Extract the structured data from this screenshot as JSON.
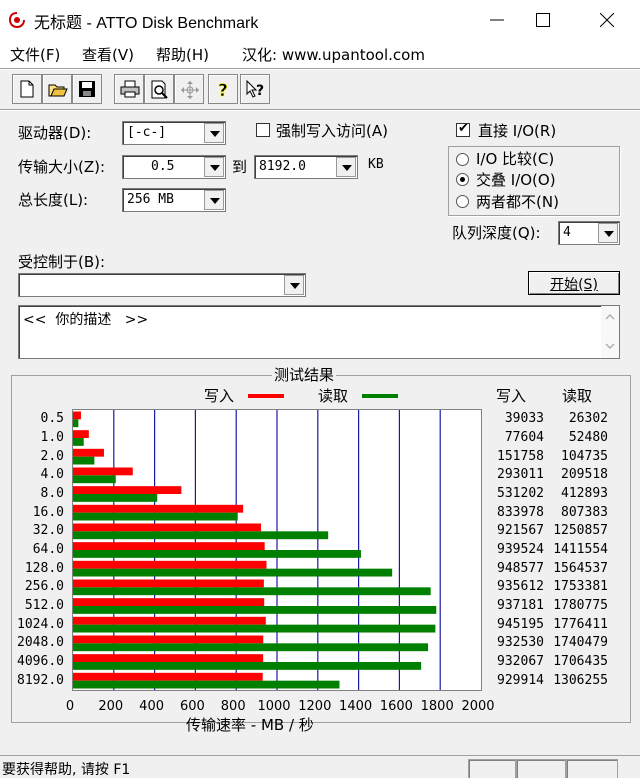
{
  "window": {
    "title": "无标题 - ATTO Disk Benchmark"
  },
  "menu": {
    "file": "文件(F)",
    "view": "查看(V)",
    "help": "帮助(H)",
    "localized": "汉化: www.upantool.com"
  },
  "toolbar": {
    "icons": [
      "new-file-icon",
      "open-folder-icon",
      "save-icon",
      "print-icon",
      "print-preview-icon",
      "move-icon",
      "help-icon",
      "context-help-icon"
    ]
  },
  "settings": {
    "drive_label": "驱动器(D):",
    "drive_value": "[-c-]",
    "transfer_label": "传输大小(Z):",
    "transfer_from": "0.5",
    "to_label": "到",
    "transfer_to": "8192.0",
    "kb_label": "KB",
    "length_label": "总长度(L):",
    "length_value": "256 MB",
    "force_write_label": "强制写入访问(A)",
    "force_write_checked": false,
    "direct_io_label": "直接 I/O(R)",
    "direct_io_checked": true,
    "io_compare_label": "I/O 比较(C)",
    "overlapped_io_label": "交叠 I/O(O)",
    "neither_label": "两者都不(N)",
    "io_mode_selected": "overlapped",
    "queue_depth_label": "队列深度(Q):",
    "queue_depth_value": "4",
    "controlled_by_label": "受控制于(B):",
    "controlled_by_value": "",
    "start_button": "开始(S)",
    "description": "<<  你的描述   >>"
  },
  "chart_data": {
    "type": "bar",
    "title": "测试结果",
    "legend": [
      {
        "name": "写入",
        "color": "#ff0000"
      },
      {
        "name": "读取",
        "color": "#008000"
      }
    ],
    "categories": [
      "0.5",
      "1.0",
      "2.0",
      "4.0",
      "8.0",
      "16.0",
      "32.0",
      "64.0",
      "128.0",
      "256.0",
      "512.0",
      "1024.0",
      "2048.0",
      "4096.0",
      "8192.0"
    ],
    "series": [
      {
        "name": "写入",
        "values": [
          39033,
          77604,
          151758,
          293011,
          531202,
          833978,
          921567,
          939524,
          948577,
          935612,
          937181,
          945195,
          932530,
          932067,
          929914
        ]
      },
      {
        "name": "读取",
        "values": [
          26302,
          52480,
          104735,
          209518,
          412893,
          807383,
          1250857,
          1411554,
          1564537,
          1753381,
          1780775,
          1776411,
          1740479,
          1706435,
          1306255
        ]
      }
    ],
    "xlabel": "传输速率 - MB / 秒",
    "xticks": [
      "0",
      "200",
      "400",
      "600",
      "800",
      "1000",
      "1200",
      "1400",
      "1600",
      "1800",
      "2000"
    ],
    "xlim": [
      0,
      2000
    ],
    "write_header": "写入",
    "read_header": "读取",
    "grid": true
  },
  "status": {
    "text": "要获得帮助, 请按 F1"
  }
}
